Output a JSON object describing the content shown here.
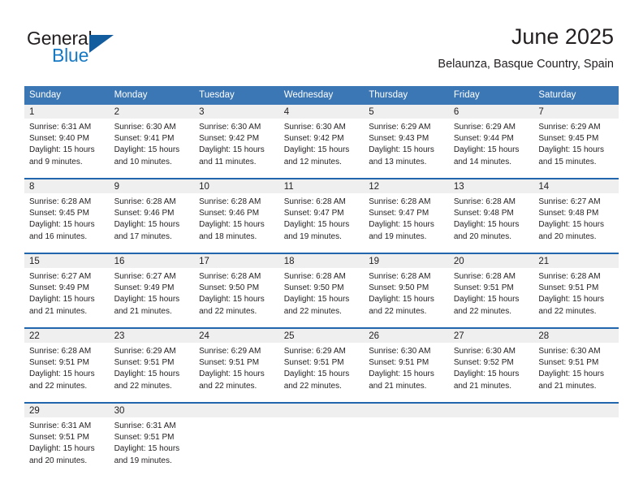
{
  "brand": {
    "name_part1": "General",
    "name_part2": "Blue",
    "accent_blue": "#1779c4",
    "triangle_blue": "#135c9e"
  },
  "header": {
    "month_title": "June 2025",
    "location": "Belaunza, Basque Country, Spain"
  },
  "theme": {
    "header_row_bg": "#3b76b5",
    "week_separator": "#2267ad",
    "daynum_band_bg": "#efefef",
    "text": "#231f20"
  },
  "weekday_headers": [
    "Sunday",
    "Monday",
    "Tuesday",
    "Wednesday",
    "Thursday",
    "Friday",
    "Saturday"
  ],
  "weeks": [
    {
      "days": [
        {
          "num": "1",
          "sunrise": "Sunrise: 6:31 AM",
          "sunset": "Sunset: 9:40 PM",
          "daylight": "Daylight: 15 hours and 9 minutes."
        },
        {
          "num": "2",
          "sunrise": "Sunrise: 6:30 AM",
          "sunset": "Sunset: 9:41 PM",
          "daylight": "Daylight: 15 hours and 10 minutes."
        },
        {
          "num": "3",
          "sunrise": "Sunrise: 6:30 AM",
          "sunset": "Sunset: 9:42 PM",
          "daylight": "Daylight: 15 hours and 11 minutes."
        },
        {
          "num": "4",
          "sunrise": "Sunrise: 6:30 AM",
          "sunset": "Sunset: 9:42 PM",
          "daylight": "Daylight: 15 hours and 12 minutes."
        },
        {
          "num": "5",
          "sunrise": "Sunrise: 6:29 AM",
          "sunset": "Sunset: 9:43 PM",
          "daylight": "Daylight: 15 hours and 13 minutes."
        },
        {
          "num": "6",
          "sunrise": "Sunrise: 6:29 AM",
          "sunset": "Sunset: 9:44 PM",
          "daylight": "Daylight: 15 hours and 14 minutes."
        },
        {
          "num": "7",
          "sunrise": "Sunrise: 6:29 AM",
          "sunset": "Sunset: 9:45 PM",
          "daylight": "Daylight: 15 hours and 15 minutes."
        }
      ]
    },
    {
      "days": [
        {
          "num": "8",
          "sunrise": "Sunrise: 6:28 AM",
          "sunset": "Sunset: 9:45 PM",
          "daylight": "Daylight: 15 hours and 16 minutes."
        },
        {
          "num": "9",
          "sunrise": "Sunrise: 6:28 AM",
          "sunset": "Sunset: 9:46 PM",
          "daylight": "Daylight: 15 hours and 17 minutes."
        },
        {
          "num": "10",
          "sunrise": "Sunrise: 6:28 AM",
          "sunset": "Sunset: 9:46 PM",
          "daylight": "Daylight: 15 hours and 18 minutes."
        },
        {
          "num": "11",
          "sunrise": "Sunrise: 6:28 AM",
          "sunset": "Sunset: 9:47 PM",
          "daylight": "Daylight: 15 hours and 19 minutes."
        },
        {
          "num": "12",
          "sunrise": "Sunrise: 6:28 AM",
          "sunset": "Sunset: 9:47 PM",
          "daylight": "Daylight: 15 hours and 19 minutes."
        },
        {
          "num": "13",
          "sunrise": "Sunrise: 6:28 AM",
          "sunset": "Sunset: 9:48 PM",
          "daylight": "Daylight: 15 hours and 20 minutes."
        },
        {
          "num": "14",
          "sunrise": "Sunrise: 6:27 AM",
          "sunset": "Sunset: 9:48 PM",
          "daylight": "Daylight: 15 hours and 20 minutes."
        }
      ]
    },
    {
      "days": [
        {
          "num": "15",
          "sunrise": "Sunrise: 6:27 AM",
          "sunset": "Sunset: 9:49 PM",
          "daylight": "Daylight: 15 hours and 21 minutes."
        },
        {
          "num": "16",
          "sunrise": "Sunrise: 6:27 AM",
          "sunset": "Sunset: 9:49 PM",
          "daylight": "Daylight: 15 hours and 21 minutes."
        },
        {
          "num": "17",
          "sunrise": "Sunrise: 6:28 AM",
          "sunset": "Sunset: 9:50 PM",
          "daylight": "Daylight: 15 hours and 22 minutes."
        },
        {
          "num": "18",
          "sunrise": "Sunrise: 6:28 AM",
          "sunset": "Sunset: 9:50 PM",
          "daylight": "Daylight: 15 hours and 22 minutes."
        },
        {
          "num": "19",
          "sunrise": "Sunrise: 6:28 AM",
          "sunset": "Sunset: 9:50 PM",
          "daylight": "Daylight: 15 hours and 22 minutes."
        },
        {
          "num": "20",
          "sunrise": "Sunrise: 6:28 AM",
          "sunset": "Sunset: 9:51 PM",
          "daylight": "Daylight: 15 hours and 22 minutes."
        },
        {
          "num": "21",
          "sunrise": "Sunrise: 6:28 AM",
          "sunset": "Sunset: 9:51 PM",
          "daylight": "Daylight: 15 hours and 22 minutes."
        }
      ]
    },
    {
      "days": [
        {
          "num": "22",
          "sunrise": "Sunrise: 6:28 AM",
          "sunset": "Sunset: 9:51 PM",
          "daylight": "Daylight: 15 hours and 22 minutes."
        },
        {
          "num": "23",
          "sunrise": "Sunrise: 6:29 AM",
          "sunset": "Sunset: 9:51 PM",
          "daylight": "Daylight: 15 hours and 22 minutes."
        },
        {
          "num": "24",
          "sunrise": "Sunrise: 6:29 AM",
          "sunset": "Sunset: 9:51 PM",
          "daylight": "Daylight: 15 hours and 22 minutes."
        },
        {
          "num": "25",
          "sunrise": "Sunrise: 6:29 AM",
          "sunset": "Sunset: 9:51 PM",
          "daylight": "Daylight: 15 hours and 22 minutes."
        },
        {
          "num": "26",
          "sunrise": "Sunrise: 6:30 AM",
          "sunset": "Sunset: 9:51 PM",
          "daylight": "Daylight: 15 hours and 21 minutes."
        },
        {
          "num": "27",
          "sunrise": "Sunrise: 6:30 AM",
          "sunset": "Sunset: 9:52 PM",
          "daylight": "Daylight: 15 hours and 21 minutes."
        },
        {
          "num": "28",
          "sunrise": "Sunrise: 6:30 AM",
          "sunset": "Sunset: 9:51 PM",
          "daylight": "Daylight: 15 hours and 21 minutes."
        }
      ]
    },
    {
      "days": [
        {
          "num": "29",
          "sunrise": "Sunrise: 6:31 AM",
          "sunset": "Sunset: 9:51 PM",
          "daylight": "Daylight: 15 hours and 20 minutes."
        },
        {
          "num": "30",
          "sunrise": "Sunrise: 6:31 AM",
          "sunset": "Sunset: 9:51 PM",
          "daylight": "Daylight: 15 hours and 19 minutes."
        },
        {
          "num": "",
          "sunrise": "",
          "sunset": "",
          "daylight": ""
        },
        {
          "num": "",
          "sunrise": "",
          "sunset": "",
          "daylight": ""
        },
        {
          "num": "",
          "sunrise": "",
          "sunset": "",
          "daylight": ""
        },
        {
          "num": "",
          "sunrise": "",
          "sunset": "",
          "daylight": ""
        },
        {
          "num": "",
          "sunrise": "",
          "sunset": "",
          "daylight": ""
        }
      ]
    }
  ]
}
